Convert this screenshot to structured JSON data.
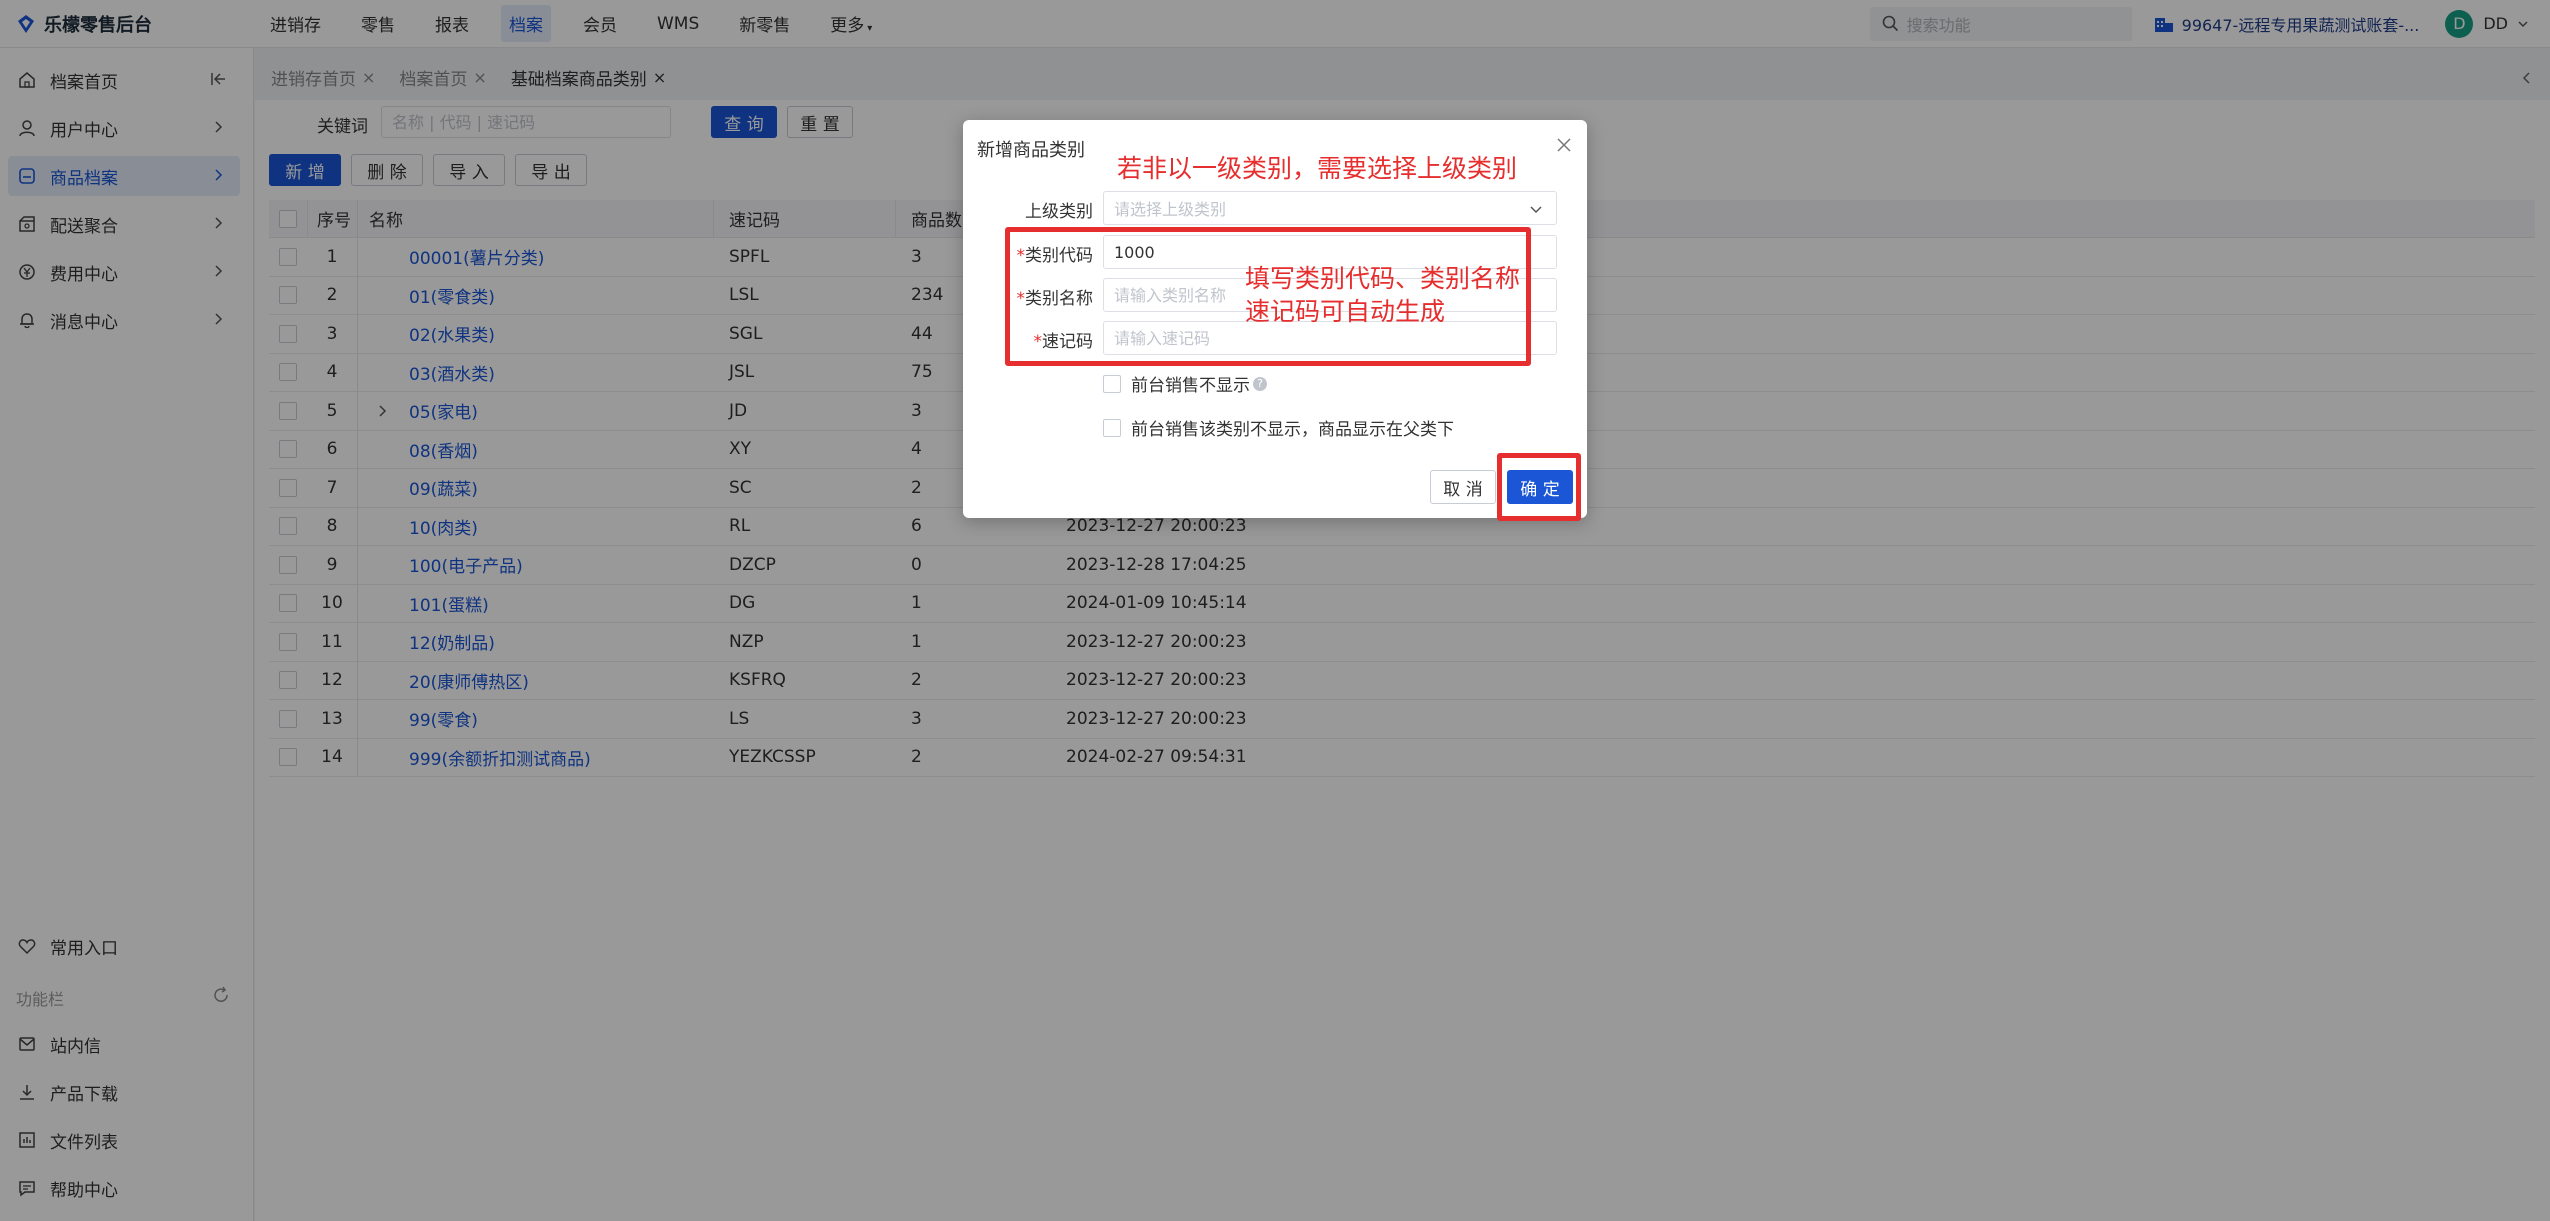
{
  "app": {
    "title": "乐檬零售后台"
  },
  "topnav": [
    {
      "label": "进销存",
      "active": false
    },
    {
      "label": "零售",
      "active": false
    },
    {
      "label": "报表",
      "active": false
    },
    {
      "label": "档案",
      "active": true
    },
    {
      "label": "会员",
      "active": false
    },
    {
      "label": "WMS",
      "active": false
    },
    {
      "label": "新零售",
      "active": false
    },
    {
      "label": "更多",
      "active": false
    }
  ],
  "header": {
    "search_placeholder": "搜索功能",
    "store": "99647-远程专用果蔬测试账套-...",
    "user_initial": "D",
    "user_name": "DD"
  },
  "sidebar": {
    "items": [
      {
        "label": "档案首页",
        "icon": "home-icon"
      },
      {
        "label": "用户中心",
        "icon": "user-icon"
      },
      {
        "label": "商品档案",
        "icon": "archive-icon"
      },
      {
        "label": "配送聚合",
        "icon": "delivery-icon"
      },
      {
        "label": "费用中心",
        "icon": "cost-icon"
      },
      {
        "label": "消息中心",
        "icon": "bell-icon"
      }
    ],
    "favorites": "常用入口",
    "section": "功能栏",
    "bottom_items": [
      {
        "label": "站内信",
        "icon": "mail-icon"
      },
      {
        "label": "产品下载",
        "icon": "download-icon"
      },
      {
        "label": "文件列表",
        "icon": "file-list-icon"
      },
      {
        "label": "帮助中心",
        "icon": "help-center-icon"
      }
    ]
  },
  "tabs": [
    {
      "label": "进销存首页",
      "active": false
    },
    {
      "label": "档案首页",
      "active": false
    },
    {
      "label": "基础档案商品类别",
      "active": true
    }
  ],
  "filter": {
    "label": "关键词",
    "placeholder": "名称 | 代码 | 速记码",
    "query": "查 询",
    "reset": "重 置"
  },
  "toolbar": {
    "add": "新 增",
    "delete": "删 除",
    "import": "导 入",
    "export": "导 出"
  },
  "table": {
    "headers": {
      "seq": "序号",
      "name": "名称",
      "code": "速记码",
      "count": "商品数"
    },
    "rows": [
      {
        "seq": "1",
        "name": "00001(薯片分类)",
        "code": "SPFL",
        "count": "3",
        "time": "",
        "expandable": false
      },
      {
        "seq": "2",
        "name": "01(零食类)",
        "code": "LSL",
        "count": "234",
        "time": "",
        "expandable": false
      },
      {
        "seq": "3",
        "name": "02(水果类)",
        "code": "SGL",
        "count": "44",
        "time": "",
        "expandable": false
      },
      {
        "seq": "4",
        "name": "03(酒水类)",
        "code": "JSL",
        "count": "75",
        "time": "",
        "expandable": false
      },
      {
        "seq": "5",
        "name": "05(家电)",
        "code": "JD",
        "count": "3",
        "time": "",
        "expandable": true
      },
      {
        "seq": "6",
        "name": "08(香烟)",
        "code": "XY",
        "count": "4",
        "time": "",
        "expandable": false
      },
      {
        "seq": "7",
        "name": "09(蔬菜)",
        "code": "SC",
        "count": "2",
        "time": "",
        "expandable": false
      },
      {
        "seq": "8",
        "name": "10(肉类)",
        "code": "RL",
        "count": "6",
        "time": "2023-12-27 20:00:23",
        "expandable": false
      },
      {
        "seq": "9",
        "name": "100(电子产品)",
        "code": "DZCP",
        "count": "0",
        "time": "2023-12-28 17:04:25",
        "expandable": false
      },
      {
        "seq": "10",
        "name": "101(蛋糕)",
        "code": "DG",
        "count": "1",
        "time": "2024-01-09 10:45:14",
        "expandable": false
      },
      {
        "seq": "11",
        "name": "12(奶制品)",
        "code": "NZP",
        "count": "1",
        "time": "2023-12-27 20:00:23",
        "expandable": false
      },
      {
        "seq": "12",
        "name": "20(康师傅热区)",
        "code": "KSFRQ",
        "count": "2",
        "time": "2023-12-27 20:00:23",
        "expandable": false
      },
      {
        "seq": "13",
        "name": "99(零食)",
        "code": "LS",
        "count": "3",
        "time": "2023-12-27 20:00:23",
        "expandable": false
      },
      {
        "seq": "14",
        "name": "999(余额折扣测试商品)",
        "code": "YEZKCSSP",
        "count": "2",
        "time": "2024-02-27 09:54:31",
        "expandable": false
      }
    ]
  },
  "modal": {
    "title": "新增商品类别",
    "parent_label": "上级类别",
    "parent_placeholder": "请选择上级类别",
    "code_label": "类别代码",
    "code_value": "1000",
    "name_label": "类别名称",
    "name_placeholder": "请输入类别名称",
    "shortcode_label": "速记码",
    "shortcode_placeholder": "请输入速记码",
    "required_mark": "*",
    "check1": "前台销售不显示",
    "check2": "前台销售该类别不显示，商品显示在父类下",
    "cancel": "取 消",
    "ok": "确 定"
  },
  "annotations": {
    "top": "若非以一级类别，需要选择上级类别",
    "middle_line1": "填写类别代码、类别名称",
    "middle_line2": "速记码可自动生成"
  },
  "colors": {
    "accent": "#1a56d6",
    "annotation": "#e62e2e",
    "overlay": "rgba(0,0,0,0.4)"
  }
}
